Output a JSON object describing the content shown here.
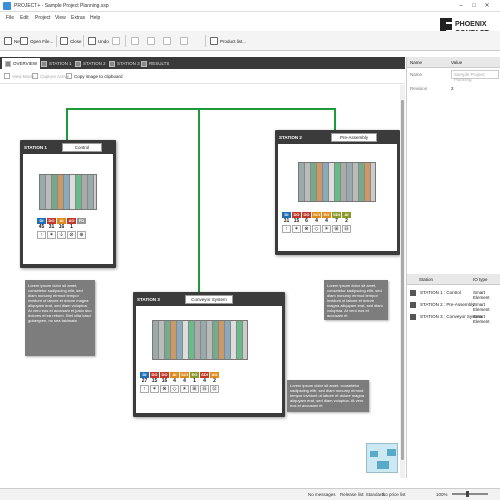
{
  "window": {
    "title": "PROJECT+ - Sample Project Planning.ssp",
    "min": "–",
    "max": "□",
    "close": "✕"
  },
  "menu": [
    "File",
    "Edit",
    "Project",
    "View",
    "Extras",
    "Help"
  ],
  "toolbar": {
    "new": "New",
    "open": "Open File...",
    "close": "Close",
    "undo": "Undo",
    "product_list": "Product list..."
  },
  "tabs": [
    "OVERVIEW",
    "STATION 1",
    "STATION 2",
    "STATION 3",
    "RESULTS"
  ],
  "subtool": {
    "view_mode": "View Mode",
    "capture": "Capture Active",
    "copy": "Copy image to clipboard"
  },
  "stations": [
    {
      "label": "STATION 1",
      "name": "Control",
      "badges": [
        {
          "t": "DI",
          "n": "45",
          "c": "#1f6fb5",
          "i": "↑"
        },
        {
          "t": "DO",
          "n": "31",
          "c": "#c0392b",
          "i": "✶"
        },
        {
          "t": "AI",
          "n": "16",
          "c": "#e08a1c",
          "i": "⏚"
        },
        {
          "t": "AO",
          "n": "1",
          "c": "#c0392b",
          "i": "⊘"
        },
        {
          "t": "FD",
          "n": "",
          "c": "#999",
          "i": "⊕"
        }
      ]
    },
    {
      "label": "STATION 2",
      "name": "Pre-Assembly",
      "badges": [
        {
          "t": "DI",
          "n": "31",
          "c": "#1f6fb5",
          "i": "↑"
        },
        {
          "t": "DO",
          "n": "15",
          "c": "#c0392b",
          "i": "✶"
        },
        {
          "t": "DO",
          "n": "6",
          "c": "#c0392b",
          "i": "⊗"
        },
        {
          "t": "SCI",
          "n": "4",
          "c": "#e08a1c",
          "i": "◇"
        },
        {
          "t": "EO",
          "n": "4",
          "c": "#e08a1c",
          "i": "☀"
        },
        {
          "t": "SDI",
          "n": "7",
          "c": "#8a9a2a",
          "i": "⊞"
        },
        {
          "t": "AI",
          "n": "2",
          "c": "#8a9a2a",
          "i": "⊟"
        }
      ]
    },
    {
      "label": "STATION 3",
      "name": "Conveyor System",
      "badges": [
        {
          "t": "DI",
          "n": "27",
          "c": "#1f6fb5",
          "i": "↑"
        },
        {
          "t": "DO",
          "n": "15",
          "c": "#c0392b",
          "i": "✶"
        },
        {
          "t": "DO",
          "n": "16",
          "c": "#c0392b",
          "i": "⊗"
        },
        {
          "t": "AI",
          "n": "4",
          "c": "#e08a1c",
          "i": "◇"
        },
        {
          "t": "SCI",
          "n": "4",
          "c": "#e08a1c",
          "i": "☀"
        },
        {
          "t": "EO",
          "n": "1",
          "c": "#8a9a2a",
          "i": "⊞"
        },
        {
          "t": "SDI",
          "n": "4",
          "c": "#c0392b",
          "i": "⊟"
        },
        {
          "t": "AO",
          "n": "2",
          "c": "#e08a1c",
          "i": "⊡"
        }
      ]
    }
  ],
  "notes": [
    "Lorem ipsum dolor sit amet, consetetur sadipscing elitr, sed diam nonumy eirmod tempor invidunt ut labore et dolore magna aliquyam erat, sed diam voluptua. At vero eos et accusam et justo duo dolores et ea rebum. Stet clita kasd gubergren, no sea takimata",
    "Lorem ipsum dolor sit amet, consetetur sadipscing elitr, sed diam nonumy eirmod tempor invidunt ut labore et dolore magna aliquyam erat, sed diam voluptua. At vero eos et accusam et",
    "Lorem ipsum dolor sit amet, consetetur sadipscing elitr, sed diam nonumy eirmod tempor invidunt ut labore et dolore magna aliquyam erat, sed diam voluptua. At vero eos et accusam et"
  ],
  "properties": {
    "col_name": "Name",
    "col_value": "Value",
    "rows": [
      {
        "name": "Name",
        "value": "Sample Project Planning"
      },
      {
        "name": "Revision",
        "value": "2"
      }
    ]
  },
  "station_list": {
    "col_station": "Station",
    "col_io": "IO type",
    "rows": [
      {
        "station": "STATION 1 : Control",
        "io": "Smart Element"
      },
      {
        "station": "STATION 2 : Pre-Assembly",
        "io": "Smart Element"
      },
      {
        "station": "STATION 3 : Conveyor System",
        "io": "Smart Element"
      }
    ]
  },
  "statusbar": {
    "messages": "No messages",
    "release": "Release list: Standard",
    "price": "No price list",
    "zoom": "100%"
  },
  "colors": {
    "bus": "#1e9a3a",
    "station_frame": "#3b3b3b",
    "note": "#7d7d7d"
  }
}
